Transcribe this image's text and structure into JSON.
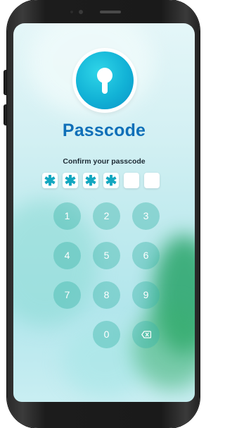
{
  "screen": {
    "title": "Passcode",
    "subtitle": "Confirm your passcode"
  },
  "pin": {
    "slots": [
      "✱",
      "✱",
      "✱",
      "✱",
      "",
      ""
    ]
  },
  "keypad": {
    "keys": [
      "1",
      "2",
      "3",
      "4",
      "5",
      "6",
      "7",
      "8",
      "9",
      "0"
    ],
    "backspace_icon": "backspace-icon"
  },
  "colors": {
    "accent": "#0f6fb8",
    "lock_gradient": "#12b2d6",
    "key_fill": "#3cb4aa",
    "pin_glyph": "#13a7c0"
  },
  "icons": {
    "lock": "keyhole-icon"
  }
}
